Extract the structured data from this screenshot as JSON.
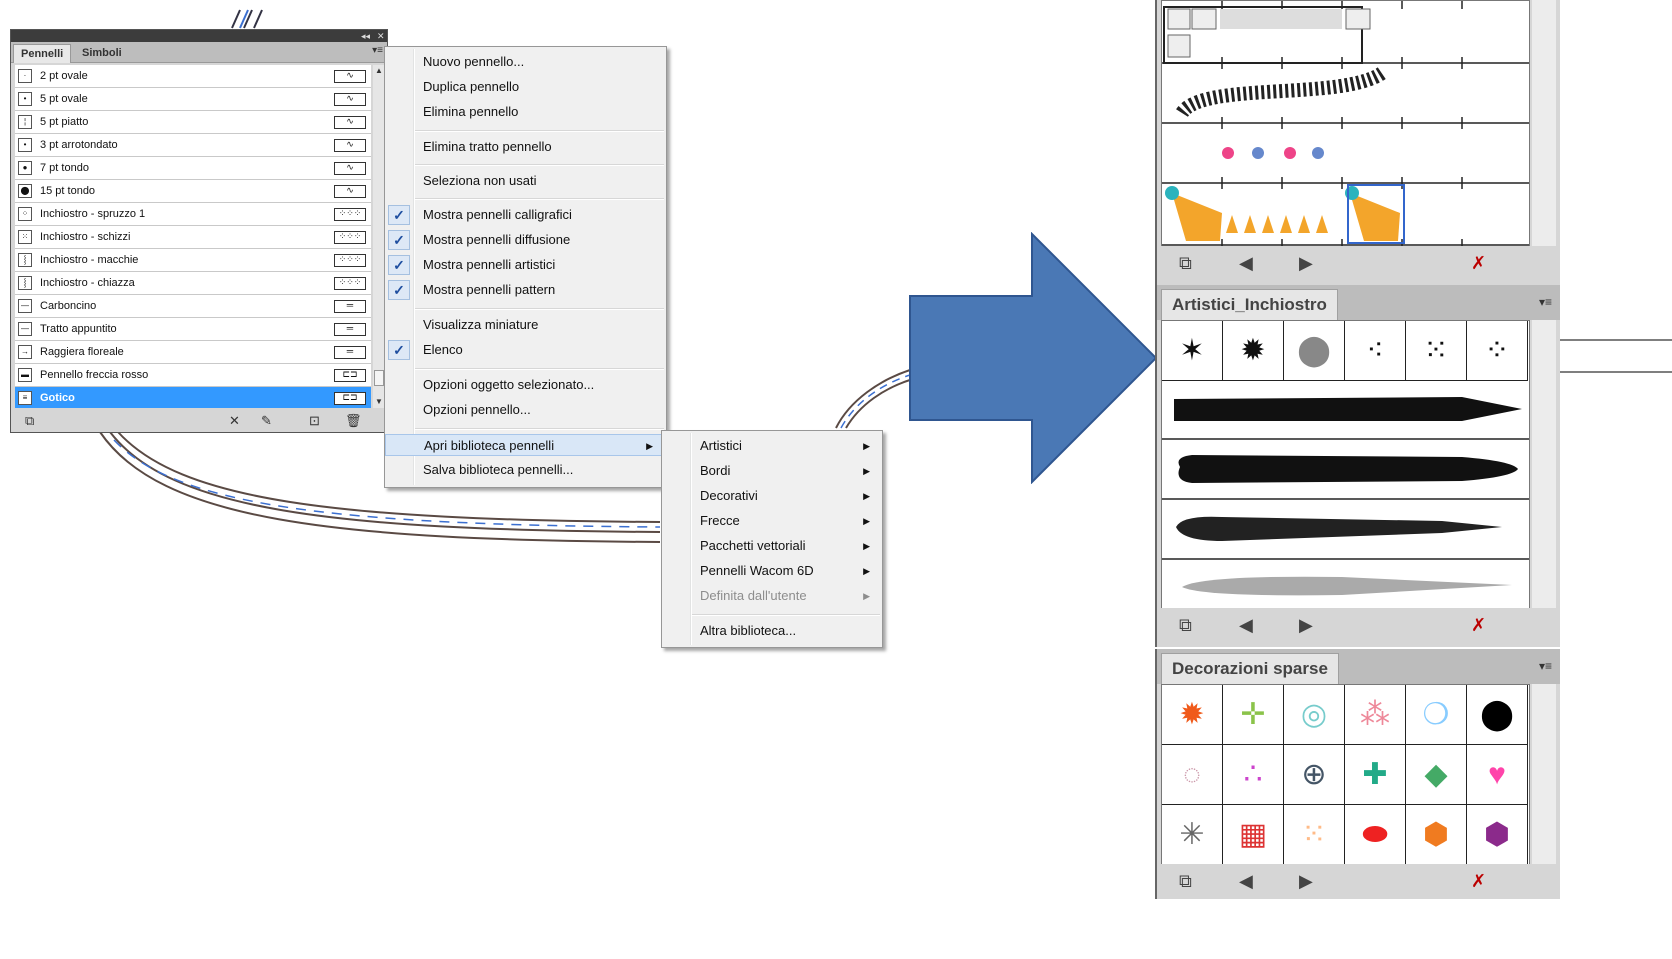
{
  "brushes_panel": {
    "tabs": [
      "Pennelli",
      "Simboli"
    ],
    "items": [
      {
        "name": "2 pt ovale",
        "thumb": "·",
        "stroke": "∿"
      },
      {
        "name": "5 pt ovale",
        "thumb": "•",
        "stroke": "∿"
      },
      {
        "name": "5 pt piatto",
        "thumb": "¦",
        "stroke": "∿"
      },
      {
        "name": "3 pt arrotondato",
        "thumb": "•",
        "stroke": "∿"
      },
      {
        "name": "7 pt tondo",
        "thumb": "●",
        "stroke": "∿"
      },
      {
        "name": "15 pt tondo",
        "thumb": "⬤",
        "stroke": "∿"
      },
      {
        "name": "Inchiostro - spruzzo 1",
        "thumb": "⁘",
        "stroke": "⁘⁘⁘"
      },
      {
        "name": "Inchiostro - schizzi",
        "thumb": "⁙",
        "stroke": "⁘⁘⁘"
      },
      {
        "name": "Inchiostro - macchie",
        "thumb": "⸾",
        "stroke": "⁘⁘⁘"
      },
      {
        "name": "Inchiostro - chiazza",
        "thumb": "⸾",
        "stroke": "⁘⁘⁘"
      },
      {
        "name": "Carboncino",
        "thumb": "—",
        "stroke": "═"
      },
      {
        "name": "Tratto appuntito",
        "thumb": "—",
        "stroke": "═"
      },
      {
        "name": "Raggiera floreale",
        "thumb": "→",
        "stroke": "═"
      },
      {
        "name": "Pennello freccia rosso",
        "thumb": "▬",
        "stroke": "⊏⊐"
      },
      {
        "name": "Gotico",
        "thumb": "≡",
        "stroke": "⊏⊐"
      }
    ],
    "selected_index": 14
  },
  "panel_menu": {
    "items": [
      {
        "label": "Nuovo pennello...",
        "checked": false
      },
      {
        "label": "Duplica pennello",
        "checked": false
      },
      {
        "label": "Elimina pennello",
        "checked": false
      },
      {
        "label": "Elimina tratto pennello",
        "checked": false
      },
      {
        "label": "Seleziona non usati",
        "checked": false
      },
      {
        "label": "Mostra pennelli calligrafici",
        "checked": true
      },
      {
        "label": "Mostra pennelli diffusione",
        "checked": true
      },
      {
        "label": "Mostra pennelli artistici",
        "checked": true
      },
      {
        "label": "Mostra pennelli pattern",
        "checked": true
      },
      {
        "label": "Visualizza miniature",
        "checked": false
      },
      {
        "label": "Elenco",
        "checked": true
      },
      {
        "label": "Opzioni oggetto selezionato...",
        "checked": false
      },
      {
        "label": "Opzioni pennello...",
        "checked": false
      },
      {
        "label": "Apri biblioteca pennelli",
        "checked": false,
        "submenu": true,
        "highlighted": true
      },
      {
        "label": "Salva biblioteca pennelli...",
        "checked": false
      }
    ],
    "check_glyph": "✓",
    "arrow_glyph": "▶"
  },
  "library_submenu": {
    "items": [
      {
        "label": "Artistici",
        "submenu": true
      },
      {
        "label": "Bordi",
        "submenu": true
      },
      {
        "label": "Decorativi",
        "submenu": true
      },
      {
        "label": "Frecce",
        "submenu": true
      },
      {
        "label": "Pacchetti vettoriali",
        "submenu": true
      },
      {
        "label": "Pennelli Wacom 6D",
        "submenu": true
      },
      {
        "label": "Definita dall'utente",
        "submenu": true,
        "disabled": true
      },
      {
        "label": "Altra biblioteca...",
        "submenu": false
      }
    ]
  },
  "library_panels": [
    {
      "title": "",
      "kind": "pattern-brushes"
    },
    {
      "title": "Artistici_Inchiostro",
      "kind": "art-brushes"
    },
    {
      "title": "Decorazioni sparse",
      "kind": "scatter-brushes"
    }
  ],
  "colors": {
    "selection": "#3399ff",
    "arrow": "#4a78b5",
    "menu_highlight": "#d9e7f7",
    "check": "#1f4fa0"
  }
}
